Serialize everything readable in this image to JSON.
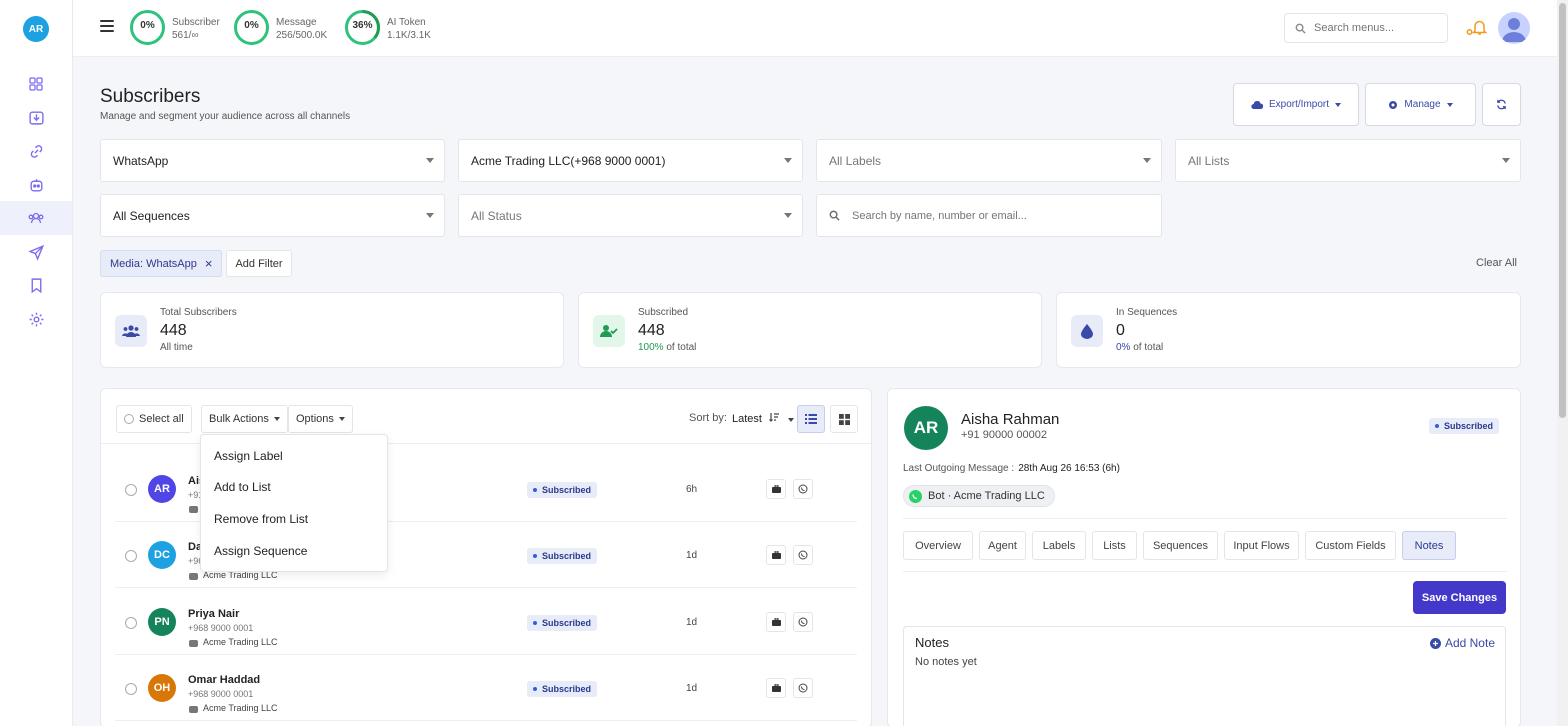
{
  "user_initials": "AR",
  "meters": [
    {
      "value": "0%",
      "name": "Subscriber",
      "detail": "561/∞",
      "percent": 0
    },
    {
      "value": "0%",
      "name": "Message",
      "detail": "256/500.0K",
      "percent": 0
    },
    {
      "value": "36%",
      "name": "AI Token",
      "detail": "1.1K/3.1K",
      "percent": 36
    }
  ],
  "top_search_placeholder": "Search menus...",
  "page": {
    "title": "Subscribers",
    "subtitle": "Manage and segment your audience across all channels",
    "export_label": "Export/Import",
    "manage_label": "Manage"
  },
  "filters": {
    "channel": "WhatsApp",
    "account": "Acme Trading LLC(+968 9000 0001)",
    "labels": "All Labels",
    "lists": "All Lists",
    "sequences": "All Sequences",
    "status": "All Status",
    "search_placeholder": "Search by name, number or email..."
  },
  "chip": {
    "label": "Media: WhatsApp"
  },
  "add_filter_label": "Add Filter",
  "clear_all_label": "Clear All",
  "stats": [
    {
      "label": "Total Subscribers",
      "value": "448",
      "sub_prefix": "",
      "sub": "All time"
    },
    {
      "label": "Subscribed",
      "value": "448",
      "sub_prefix": "100%",
      "sub": " of total"
    },
    {
      "label": "In Sequences",
      "value": "0",
      "sub_prefix": "0%",
      "sub": " of total"
    }
  ],
  "list": {
    "select_all": "Select all",
    "bulk_actions": "Bulk Actions",
    "options": "Options",
    "sort_label": "Sort by:",
    "sort_value": "Latest",
    "rows": [
      {
        "initials": "AR",
        "name": "Ais",
        "phone": "+91",
        "company": "",
        "status": "Subscribed",
        "time": "6h",
        "color": "#4f46e5"
      },
      {
        "initials": "DC",
        "name": "Da",
        "phone": "+96",
        "company": "Acme Trading LLC",
        "status": "Subscribed",
        "time": "1d",
        "color": "#1ea1e0"
      },
      {
        "initials": "PN",
        "name": "Priya Nair",
        "phone": "+968 9000 0001",
        "company": "Acme Trading LLC",
        "status": "Subscribed",
        "time": "1d",
        "color": "#16845a"
      },
      {
        "initials": "OH",
        "name": "Omar Haddad",
        "phone": "+968 9000 0001",
        "company": "Acme Trading LLC",
        "status": "Subscribed",
        "time": "1d",
        "color": "#d97706"
      }
    ]
  },
  "bulk_menu": [
    "Assign Label",
    "Add to List",
    "Remove from List",
    "Assign Sequence"
  ],
  "detail": {
    "initials": "AR",
    "name": "Aisha Rahman",
    "phone": "+91 90000 00002",
    "status": "Subscribed",
    "last_msg_label": "Last Outgoing Message :",
    "last_msg_value": "28th Aug 26 16:53 (6h)",
    "bot": "Bot · Acme Trading LLC",
    "tabs": [
      "Overview",
      "Agent",
      "Labels",
      "Lists",
      "Sequences",
      "Input Flows",
      "Custom Fields",
      "Notes"
    ],
    "save_label": "Save Changes",
    "notes_title": "Notes",
    "add_note": "Add Note",
    "notes_empty": "No notes yet"
  }
}
